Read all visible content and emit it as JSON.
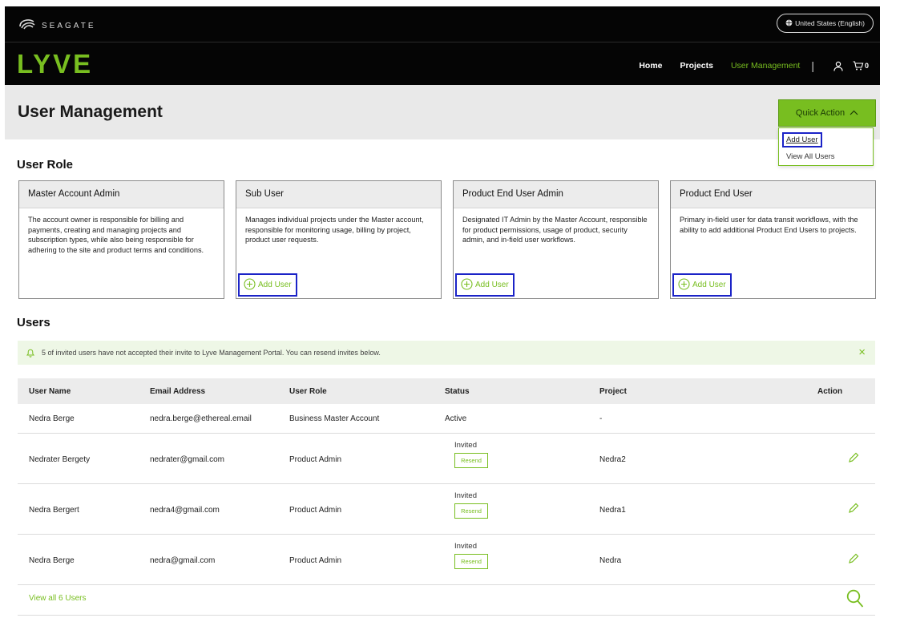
{
  "header": {
    "brand": "SEAGATE",
    "region": "United States (English)",
    "logo": "LYVE",
    "nav": {
      "home": "Home",
      "projects": "Projects",
      "user_management": "User Management",
      "divider": "|",
      "cart_count": "0"
    }
  },
  "page": {
    "title": "User Management",
    "quick_action": "Quick Action",
    "quick_menu": [
      "Add User",
      "View All Users"
    ]
  },
  "user_role": {
    "heading": "User Role",
    "cards": [
      {
        "title": "Master Account Admin",
        "desc": "The account owner is responsible for billing and payments, creating and managing projects and subscription types, while also being responsible for adhering to the site and product terms and conditions."
      },
      {
        "title": "Sub User",
        "desc": "Manages individual projects under the Master account, responsible for monitoring usage, billing by project, product user requests.",
        "add": "Add User"
      },
      {
        "title": "Product End User Admin",
        "desc": "Designated IT Admin by the Master Account, responsible for product permissions, usage of product, security admin, and in-field user workflows.",
        "add": "Add User"
      },
      {
        "title": "Product End User",
        "desc": "Primary in-field user for data transit workflows, with the ability to add additional Product End Users to projects.",
        "add": "Add User"
      }
    ]
  },
  "users": {
    "heading": "Users",
    "alert": "5 of invited users have not accepted their invite to Lyve Management Portal. You can resend invites below.",
    "close": "×",
    "columns": [
      "User Name",
      "Email Address",
      "User Role",
      "Status",
      "Project",
      "Action"
    ],
    "rows": [
      {
        "name": "Nedra Berge",
        "email": "nedra.berge@ethereal.email",
        "role": "Business Master Account",
        "status": "Active",
        "project": "-"
      },
      {
        "name": "Nedrater Bergety",
        "email": "nedrater@gmail.com",
        "role": "Product Admin",
        "status": "Invited",
        "resend": "Resend",
        "project": "Nedra2"
      },
      {
        "name": "Nedra Bergert",
        "email": "nedra4@gmail.com",
        "role": "Product Admin",
        "status": "Invited",
        "resend": "Resend",
        "project": "Nedra1"
      },
      {
        "name": "Nedra Berge",
        "email": "nedra@gmail.com",
        "role": "Product Admin",
        "status": "Invited",
        "resend": "Resend",
        "project": "Nedra"
      }
    ],
    "view_all": "View all 6 Users"
  },
  "colors": {
    "accent": "#78be20",
    "highlight": "#1b23c7",
    "header_bg": "#050505"
  },
  "icons": [
    "seagate-swirl-icon",
    "globe-icon",
    "user-icon",
    "cart-icon",
    "chevron-up-icon",
    "plus-circle-icon",
    "bell-icon",
    "close-icon",
    "edit-pencil-icon",
    "search-icon"
  ]
}
